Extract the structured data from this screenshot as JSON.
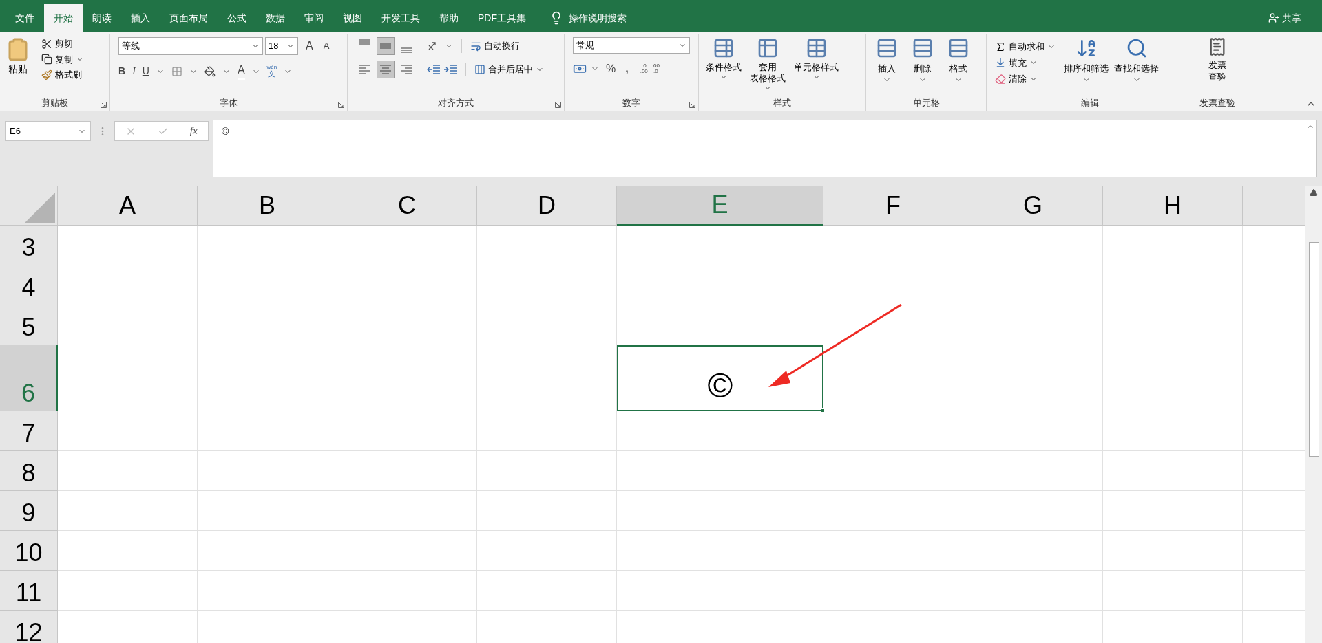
{
  "tabs": [
    {
      "label": "文件",
      "selected": false
    },
    {
      "label": "开始",
      "selected": true
    },
    {
      "label": "朗读",
      "selected": false
    },
    {
      "label": "插入",
      "selected": false
    },
    {
      "label": "页面布局",
      "selected": false
    },
    {
      "label": "公式",
      "selected": false
    },
    {
      "label": "数据",
      "selected": false
    },
    {
      "label": "审阅",
      "selected": false
    },
    {
      "label": "视图",
      "selected": false
    },
    {
      "label": "开发工具",
      "selected": false
    },
    {
      "label": "帮助",
      "selected": false
    },
    {
      "label": "PDF工具集",
      "selected": false
    }
  ],
  "tell_me": "操作说明搜索",
  "share": "共享",
  "clipboard": {
    "paste": "粘贴",
    "cut": "剪切",
    "copy": "复制",
    "format_painter": "格式刷",
    "group": "剪贴板"
  },
  "font": {
    "name": "等线",
    "size": "18",
    "grow": "A",
    "shrink": "A",
    "bold": "B",
    "italic": "I",
    "underline": "U",
    "color_letter": "A",
    "phonetic": "wén",
    "phonetic_char": "文",
    "group": "字体"
  },
  "alignment": {
    "vertical": [
      {
        "selected": false
      },
      {
        "selected": true
      },
      {
        "selected": false
      }
    ],
    "horizontal": [
      {
        "selected": false
      },
      {
        "selected": true
      },
      {
        "selected": false
      }
    ],
    "wrap": "自动换行",
    "merge": "合并后居中",
    "group": "对齐方式"
  },
  "number": {
    "format": "常规",
    "percent": "%",
    "comma": ",",
    "increase_decimal": [
      ".0",
      ".00"
    ],
    "decrease_decimal": [
      ".00",
      ".0"
    ],
    "group": "数字"
  },
  "styles": {
    "items": [
      {
        "lines": [
          "条件格式"
        ]
      },
      {
        "lines": [
          "套用",
          "表格格式"
        ]
      },
      {
        "lines": [
          "单元格样式"
        ]
      }
    ],
    "group": "样式"
  },
  "cells": {
    "items": [
      "插入",
      "删除",
      "格式"
    ],
    "group": "单元格"
  },
  "editing": {
    "autosum": "自动求和",
    "fill": "填充",
    "clear": "清除",
    "sort": "排序和筛选",
    "find": "查找和选择",
    "group": "编辑"
  },
  "invoice": {
    "lines": [
      "发票",
      "查验"
    ],
    "group": "发票查验"
  },
  "name_box": "E6",
  "function_label": "fx",
  "formula": "©",
  "columns": [
    {
      "label": "A",
      "selected": false
    },
    {
      "label": "B",
      "selected": false
    },
    {
      "label": "C",
      "selected": false
    },
    {
      "label": "D",
      "selected": false
    },
    {
      "label": "E",
      "selected": true
    },
    {
      "label": "F",
      "selected": false
    },
    {
      "label": "G",
      "selected": false
    },
    {
      "label": "H",
      "selected": false
    }
  ],
  "rows": [
    {
      "label": "3",
      "selected": false
    },
    {
      "label": "4",
      "selected": false
    },
    {
      "label": "5",
      "selected": false
    },
    {
      "label": "6",
      "selected": true
    },
    {
      "label": "7",
      "selected": false
    },
    {
      "label": "8",
      "selected": false
    },
    {
      "label": "9",
      "selected": false
    },
    {
      "label": "10",
      "selected": false
    },
    {
      "label": "11",
      "selected": false
    },
    {
      "label": "12",
      "selected": false
    }
  ],
  "active_cell_value": "©"
}
